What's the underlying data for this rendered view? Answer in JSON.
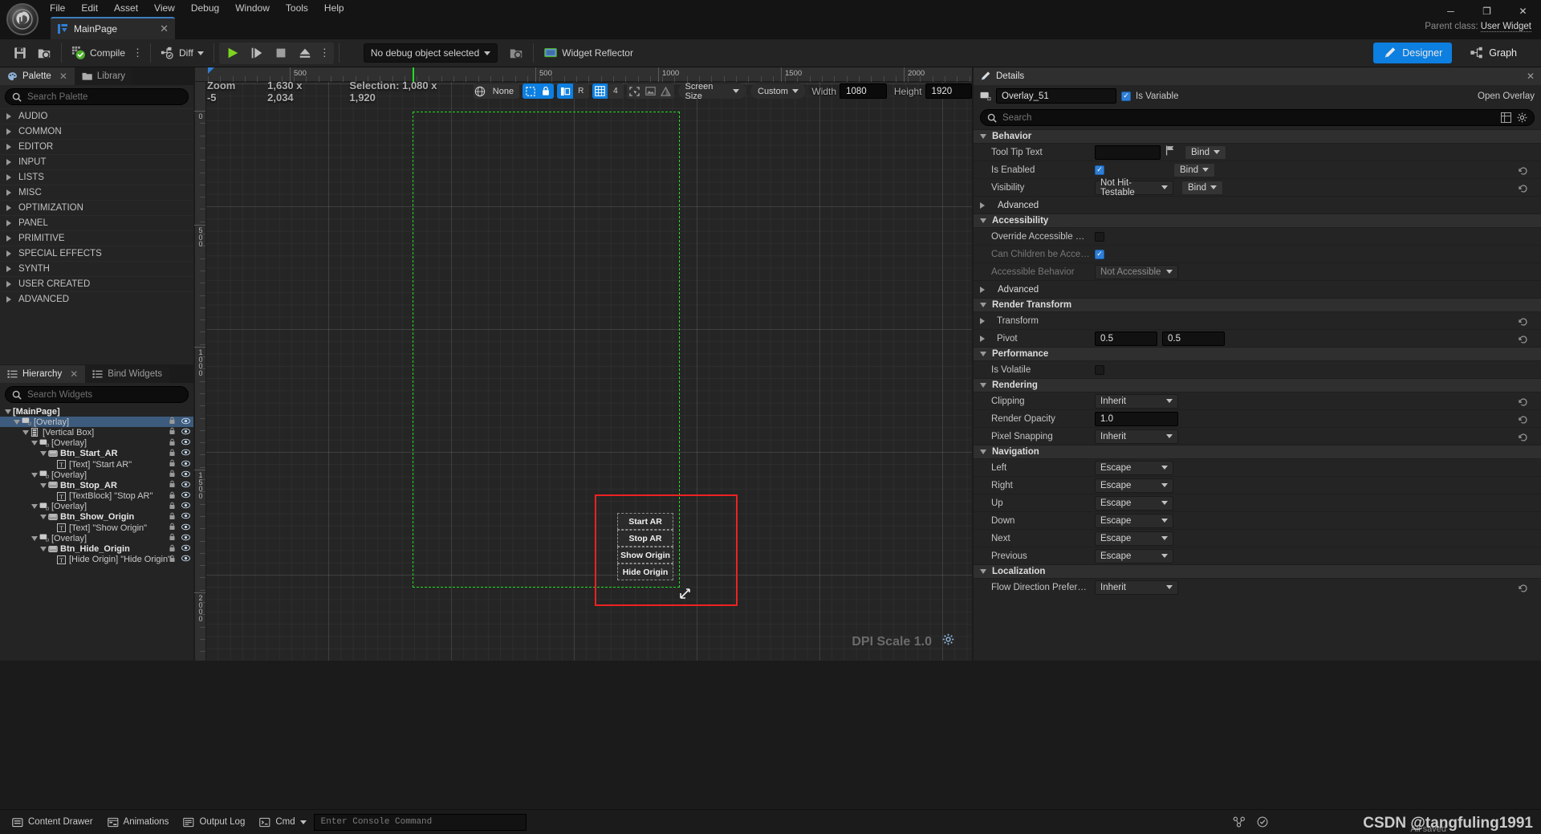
{
  "app": {
    "logo": "unreal-engine-logo",
    "parent_class_label": "Parent class:",
    "parent_class_value": "User Widget"
  },
  "menubar": {
    "items": [
      "File",
      "Edit",
      "Asset",
      "View",
      "Debug",
      "Window",
      "Tools",
      "Help"
    ]
  },
  "window_controls": {
    "minimize": "─",
    "maximize": "❐",
    "close": "✕"
  },
  "asset_tab": {
    "label": "MainPage",
    "close": "✕"
  },
  "toolbar": {
    "save": "save-icon",
    "browse": "browse-to-asset-icon",
    "compile_label": "Compile",
    "compile_options": "⋮",
    "diff_label": "Diff",
    "play": "▶",
    "step": "⏭",
    "stop": "■",
    "eject": "⏏",
    "play_options": "⋮",
    "debug_object": "No debug object selected",
    "debug_browse": "browse-debug-icon",
    "widget_reflector": "Widget Reflector",
    "designer_label": "Designer",
    "graph_label": "Graph"
  },
  "palette": {
    "tabs": [
      {
        "label": "Palette",
        "icon": "palette-icon",
        "active": true,
        "closable": true
      },
      {
        "label": "Library",
        "icon": "folder-icon",
        "active": false,
        "closable": false
      }
    ],
    "search_placeholder": "Search Palette",
    "search_value": "",
    "categories": [
      "AUDIO",
      "COMMON",
      "EDITOR",
      "INPUT",
      "LISTS",
      "MISC",
      "OPTIMIZATION",
      "PANEL",
      "PRIMITIVE",
      "SPECIAL EFFECTS",
      "SYNTH",
      "USER CREATED",
      "ADVANCED"
    ]
  },
  "hierarchy": {
    "tabs": [
      {
        "label": "Hierarchy",
        "icon": "hierarchy-icon",
        "active": true,
        "closable": true
      },
      {
        "label": "Bind Widgets",
        "icon": "bind-widgets-icon",
        "active": false,
        "closable": false
      }
    ],
    "search_placeholder": "Search Widgets",
    "search_value": "",
    "tree": [
      {
        "label": "[MainPage]",
        "depth": 0,
        "arrow": "down",
        "icon": "none",
        "bold": true,
        "selected": false,
        "controls": false
      },
      {
        "label": "[Overlay]",
        "depth": 1,
        "arrow": "down",
        "icon": "overlay",
        "bold": false,
        "selected": true,
        "controls": true
      },
      {
        "label": "[Vertical Box]",
        "depth": 2,
        "arrow": "down",
        "icon": "vbox",
        "bold": false,
        "selected": false,
        "controls": true
      },
      {
        "label": "[Overlay]",
        "depth": 3,
        "arrow": "down",
        "icon": "overlay",
        "bold": false,
        "selected": false,
        "controls": true
      },
      {
        "label": "Btn_Start_AR",
        "depth": 4,
        "arrow": "down",
        "icon": "button",
        "bold": true,
        "selected": false,
        "controls": true
      },
      {
        "label": "[Text] \"Start AR\"",
        "depth": 5,
        "arrow": "none",
        "icon": "text",
        "bold": false,
        "selected": false,
        "controls": true
      },
      {
        "label": "[Overlay]",
        "depth": 3,
        "arrow": "down",
        "icon": "overlay",
        "bold": false,
        "selected": false,
        "controls": true
      },
      {
        "label": "Btn_Stop_AR",
        "depth": 4,
        "arrow": "down",
        "icon": "button",
        "bold": true,
        "selected": false,
        "controls": true
      },
      {
        "label": "[TextBlock] \"Stop AR\"",
        "depth": 5,
        "arrow": "none",
        "icon": "text",
        "bold": false,
        "selected": false,
        "controls": true
      },
      {
        "label": "[Overlay]",
        "depth": 3,
        "arrow": "down",
        "icon": "overlay",
        "bold": false,
        "selected": false,
        "controls": true
      },
      {
        "label": "Btn_Show_Origin",
        "depth": 4,
        "arrow": "down",
        "icon": "button",
        "bold": true,
        "selected": false,
        "controls": true
      },
      {
        "label": "[Text] \"Show Origin\"",
        "depth": 5,
        "arrow": "none",
        "icon": "text",
        "bold": false,
        "selected": false,
        "controls": true
      },
      {
        "label": "[Overlay]",
        "depth": 3,
        "arrow": "down",
        "icon": "overlay",
        "bold": false,
        "selected": false,
        "controls": true
      },
      {
        "label": "Btn_Hide_Origin",
        "depth": 4,
        "arrow": "down",
        "icon": "button",
        "bold": true,
        "selected": false,
        "controls": true
      },
      {
        "label": "[Hide Origin] \"Hide Origin\"",
        "depth": 5,
        "arrow": "none",
        "icon": "text",
        "bold": false,
        "selected": false,
        "controls": true
      }
    ]
  },
  "viewport": {
    "zoom_label": "Zoom -5",
    "resolution_label": "1,630 x 2,034",
    "selection_label": "Selection: 1,080 x 1,920",
    "globe_value": "None",
    "grid_snap_value": "4",
    "rotate_label": "R",
    "screen_size_label": "Screen Size",
    "custom_label": "Custom",
    "width_label": "Width",
    "width_value": "1080",
    "height_label": "Height",
    "height_value": "1920",
    "dpi_label": "DPI Scale 1.0",
    "ruler_h_labels": [
      "500",
      "500",
      "1000",
      "1500",
      "2000"
    ],
    "ruler_v_labels": [
      "0",
      "500",
      "1000",
      "1500",
      "2000"
    ],
    "buttons": [
      "Start AR",
      "Stop AR",
      "Show Origin",
      "Hide Origin"
    ],
    "selection_outline_color": "#22dd22",
    "highlight_outline_color": "#ee2222"
  },
  "details": {
    "title": "Details",
    "close": "✕",
    "widget_name": "Overlay_51",
    "is_variable_label": "Is Variable",
    "open_overlay_label": "Open Overlay",
    "search_placeholder": "Search",
    "search_value": "",
    "sections": [
      {
        "name": "Behavior",
        "expanded": true,
        "rows": [
          {
            "label": "Tool Tip Text",
            "type": "text-flag-bind",
            "value": "",
            "bind": "Bind",
            "reset": false
          },
          {
            "label": "Is Enabled",
            "type": "checkbox-bind",
            "checked": true,
            "bind": "Bind",
            "reset": true
          },
          {
            "label": "Visibility",
            "type": "dropdown-bind",
            "value": "Not Hit-Testable",
            "bind": "Bind",
            "reset": true
          }
        ]
      },
      {
        "name": "Advanced",
        "expanded": false,
        "is_sub": true,
        "rows": []
      },
      {
        "name": "Accessibility",
        "expanded": true,
        "rows": [
          {
            "label": "Override Accessible Defaul...",
            "type": "checkbox",
            "checked": false,
            "reset": false
          },
          {
            "label": "Can Children be Accessible",
            "type": "checkbox",
            "checked": true,
            "dim": true,
            "reset": false
          },
          {
            "label": "Accessible Behavior",
            "type": "dropdown",
            "value": "Not Accessible",
            "dim": true,
            "reset": false
          }
        ]
      },
      {
        "name": "Advanced",
        "expanded": false,
        "is_sub": true,
        "rows": []
      },
      {
        "name": "Render Transform",
        "expanded": true,
        "rows": [
          {
            "label": "Transform",
            "type": "expandable",
            "reset": true
          },
          {
            "label": "Pivot",
            "type": "two-number",
            "value": "0.5",
            "value2": "0.5",
            "expandable": true,
            "reset": true
          }
        ]
      },
      {
        "name": "Performance",
        "expanded": true,
        "rows": [
          {
            "label": "Is Volatile",
            "type": "checkbox",
            "checked": false,
            "reset": false
          }
        ]
      },
      {
        "name": "Rendering",
        "expanded": true,
        "rows": [
          {
            "label": "Clipping",
            "type": "dropdown",
            "value": "Inherit",
            "reset": true
          },
          {
            "label": "Render Opacity",
            "type": "number",
            "value": "1.0",
            "reset": true
          },
          {
            "label": "Pixel Snapping",
            "type": "dropdown",
            "value": "Inherit",
            "reset": true
          }
        ]
      },
      {
        "name": "Navigation",
        "expanded": true,
        "rows": [
          {
            "label": "Left",
            "type": "dropdown-sm",
            "value": "Escape",
            "reset": false
          },
          {
            "label": "Right",
            "type": "dropdown-sm",
            "value": "Escape",
            "reset": false
          },
          {
            "label": "Up",
            "type": "dropdown-sm",
            "value": "Escape",
            "reset": false
          },
          {
            "label": "Down",
            "type": "dropdown-sm",
            "value": "Escape",
            "reset": false
          },
          {
            "label": "Next",
            "type": "dropdown-sm",
            "value": "Escape",
            "reset": false
          },
          {
            "label": "Previous",
            "type": "dropdown-sm",
            "value": "Escape",
            "reset": false
          }
        ]
      },
      {
        "name": "Localization",
        "expanded": true,
        "rows": [
          {
            "label": "Flow Direction Preference",
            "type": "dropdown",
            "value": "Inherit",
            "reset": true
          }
        ]
      }
    ]
  },
  "statusbar": {
    "content_drawer": "Content Drawer",
    "animations": "Animations",
    "output_log": "Output Log",
    "cmd_label": "Cmd",
    "console_placeholder": "Enter Console Command",
    "console_value": "",
    "watermark": "CSDN @tangfuling1991",
    "watermark_sub": "All saved"
  },
  "colors": {
    "accent": "#0d7fe0",
    "selection_green": "#22dd22",
    "highlight_red": "#ee2222",
    "tree_selected": "#3d5b7d",
    "panel_bg": "#242424",
    "viewport_bg": "#252525"
  }
}
